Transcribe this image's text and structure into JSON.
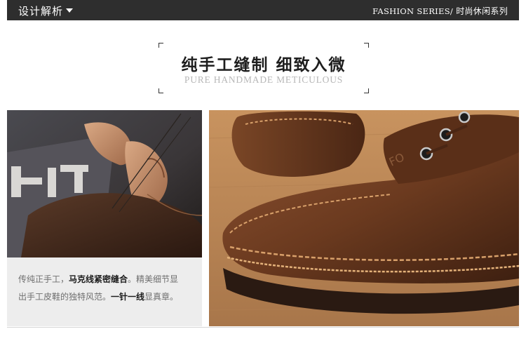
{
  "header": {
    "section_title": "设计解析",
    "series_en": "FASHION SERIES/",
    "series_cn": " 时尚休闲系列"
  },
  "heading": {
    "title_cn": "纯手工缝制 细致入微",
    "title_en": "PURE HANDMADE METICULOUS"
  },
  "images": {
    "left": {
      "name": "craftsman-stitching-photo"
    },
    "right": {
      "name": "brown-leather-shoe-closeup",
      "logo_text": "FO"
    }
  },
  "caption": {
    "line1_a": "传纯正手工，",
    "line1_b": "马克线紧密缝合",
    "line1_c": "。精美细节显",
    "line2_a": "出手工皮鞋的独特风范。",
    "line2_b": "一针一线",
    "line2_c": "显真章。"
  },
  "colors": {
    "topbar": "#2e2e2e",
    "caption_bg": "#ededed",
    "leather": "#6b3a1f"
  }
}
